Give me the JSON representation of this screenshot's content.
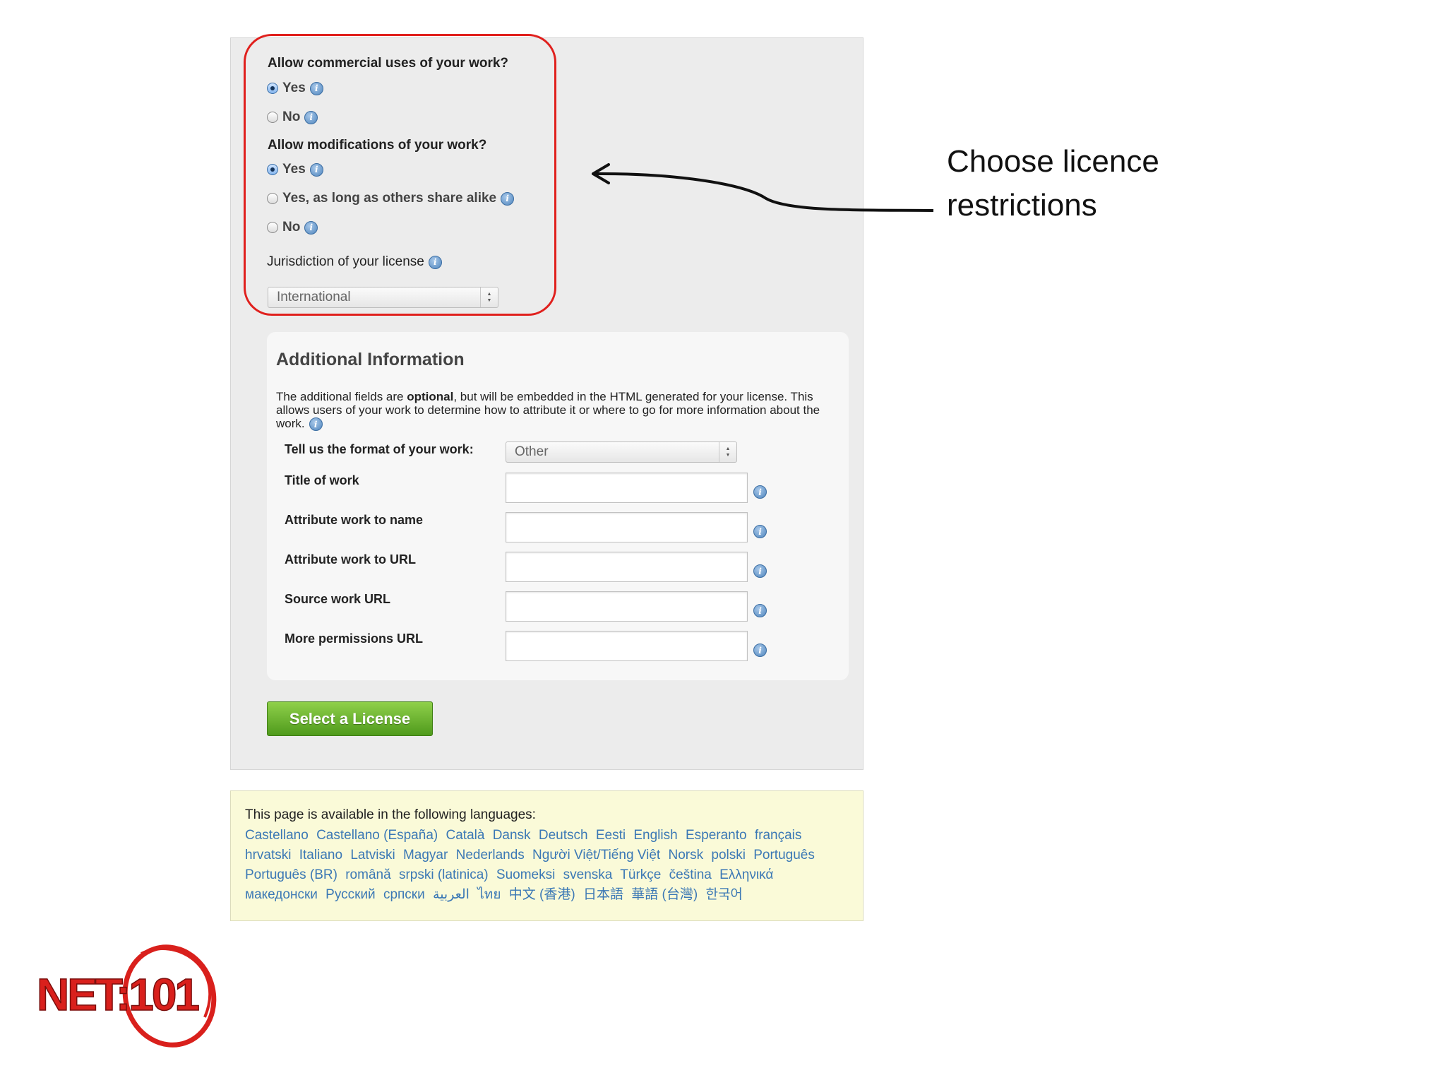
{
  "license_options": {
    "commercial_question": "Allow commercial uses of your work?",
    "commercial_options": [
      {
        "label": "Yes",
        "checked": true
      },
      {
        "label": "No",
        "checked": false
      }
    ],
    "modifications_question": "Allow modifications of your work?",
    "modifications_options": [
      {
        "label": "Yes",
        "checked": true
      },
      {
        "label": "Yes, as long as others share alike",
        "checked": false
      },
      {
        "label": "No",
        "checked": false
      }
    ],
    "jurisdiction_label": "Jurisdiction of your license",
    "jurisdiction_value": "International",
    "highlight_color": "#e0201d"
  },
  "additional_info": {
    "title": "Additional Information",
    "desc_before": "The additional fields are ",
    "desc_bold": "optional",
    "desc_after": ", but will be embedded in the HTML generated for your license. This allows users of your work to determine how to attribute it or where to go for more information about the work.",
    "format_label": "Tell us the format of your work:",
    "format_value": "Other",
    "fields": [
      {
        "label": "Title of work",
        "value": ""
      },
      {
        "label": "Attribute work to name",
        "value": ""
      },
      {
        "label": "Attribute work to URL",
        "value": ""
      },
      {
        "label": "Source work URL",
        "value": ""
      },
      {
        "label": "More permissions URL",
        "value": ""
      }
    ]
  },
  "select_button": {
    "label": "Select a License",
    "color": "#5aa524"
  },
  "languages": {
    "intro": "This page is available in the following languages:",
    "items": [
      "Castellano",
      "Castellano (España)",
      "Català",
      "Dansk",
      "Deutsch",
      "Eesti",
      "English",
      "Esperanto",
      "français",
      "hrvatski",
      "Italiano",
      "Latviski",
      "Magyar",
      "Nederlands",
      "Người Việt/Tiếng Việt",
      "Norsk",
      "polski",
      "Português",
      "Português (BR)",
      "română",
      "srpski (latinica)",
      "Suomeksi",
      "svenska",
      "Türkçe",
      "čeština",
      "Ελληνικά",
      "македонски",
      "Русский",
      "српски",
      "العربية",
      "ไทย",
      "中文 (香港)",
      "日本語",
      "華語 (台灣)",
      "한국어"
    ],
    "link_color": "#3b78b5"
  },
  "callout": {
    "line1": "Choose licence",
    "line2": "restrictions"
  },
  "logo": {
    "text": "NET:101",
    "color": "#d9201c"
  }
}
